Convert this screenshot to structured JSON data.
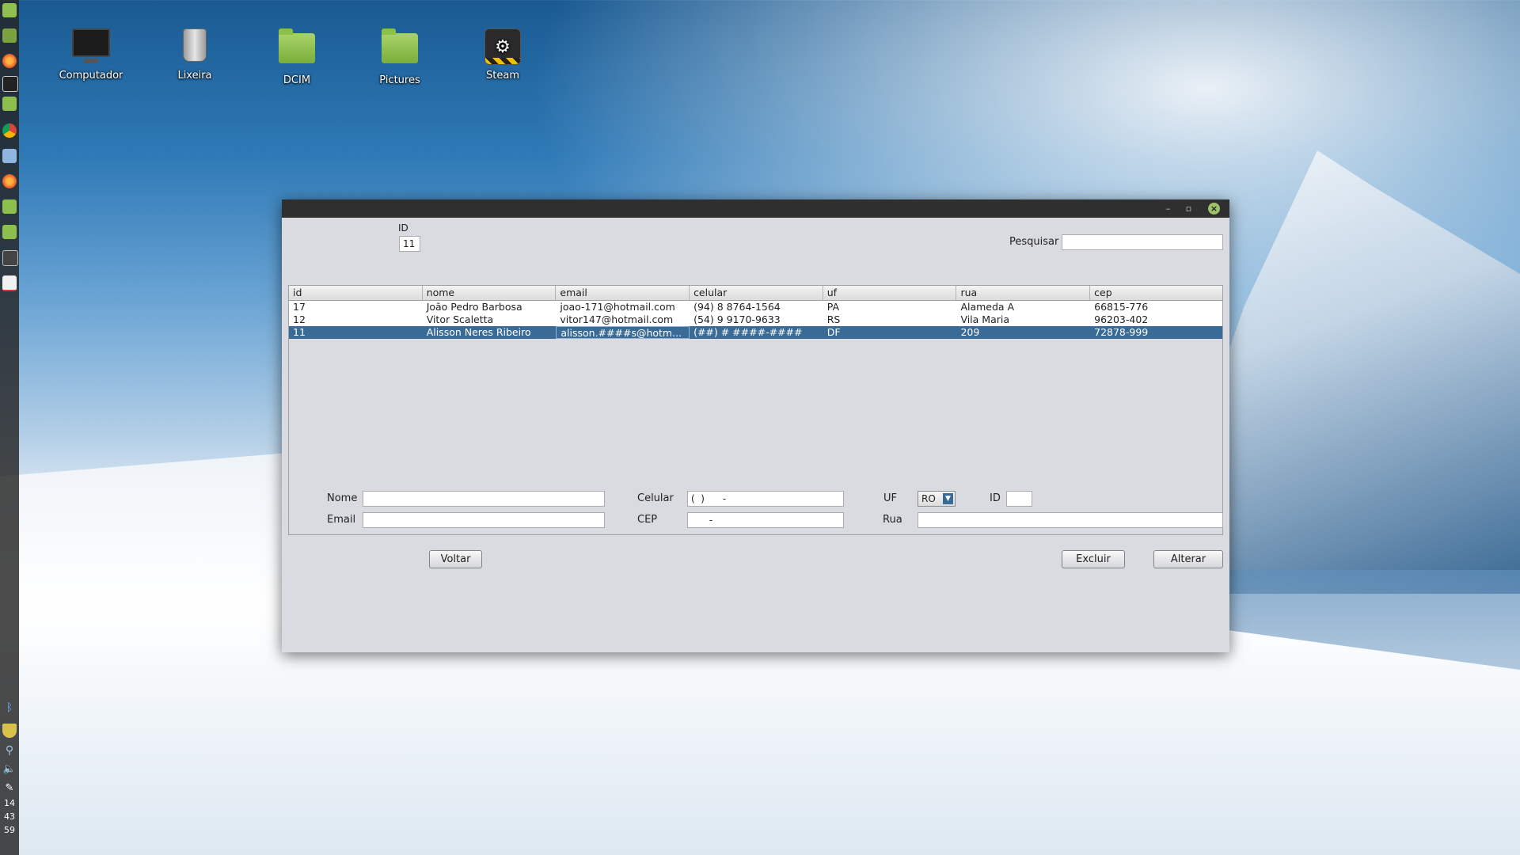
{
  "desktop": {
    "icons": [
      {
        "label": "Computador",
        "icon": "computer-icon"
      },
      {
        "label": "Lixeira",
        "icon": "trash-icon"
      },
      {
        "label": "DCIM",
        "icon": "folder-icon"
      },
      {
        "label": "Pictures",
        "icon": "folder-icon"
      },
      {
        "label": "Steam",
        "icon": "steam-icon"
      }
    ]
  },
  "panel": {
    "clock": {
      "hour": "14",
      "minute": "43",
      "second": "59"
    },
    "launchers": [
      "mint-menu-icon",
      "show-desktop-icon",
      "firefox-icon",
      "terminal-icon",
      "files-icon",
      "chrome-icon",
      "virtualbox-icon",
      "firefox-icon",
      "folder-icon",
      "folder-icon",
      "media-player-icon",
      "java-icon"
    ],
    "tray": [
      "bluetooth-icon",
      "shield-icon",
      "network-icon",
      "volume-icon",
      "pen-icon"
    ]
  },
  "window": {
    "title_controls": {
      "minimize": "–",
      "maximize": "▫",
      "close": "×"
    },
    "top": {
      "id_label": "ID",
      "id_value": "11",
      "search_label": "Pesquisar",
      "search_value": ""
    },
    "table": {
      "columns": [
        "id",
        "nome",
        "email",
        "celular",
        "uf",
        "rua",
        "cep"
      ],
      "rows": [
        [
          "17",
          "João Pedro Barbosa",
          "joao-171@hotmail.com",
          "(94) 8 8764-1564",
          "PA",
          "Alameda A",
          "66815-776"
        ],
        [
          "12",
          "Vitor Scaletta",
          "vitor147@hotmail.com",
          "(54) 9 9170-9633",
          "RS",
          "Vila Maria",
          "96203-402"
        ],
        [
          "11",
          "Alisson Neres Ribeiro",
          "alisson.####s@hotm...",
          "(##) # ####-####",
          "DF",
          "209",
          "72878-999"
        ]
      ],
      "selected_row": 2
    },
    "form": {
      "nome_label": "Nome",
      "nome_value": "",
      "email_label": "Email",
      "email_value": "",
      "celular_label": "Celular",
      "celular_value": "(  )      -",
      "cep_label": "CEP",
      "cep_value": "      -",
      "uf_label": "UF",
      "uf_value": "RO",
      "id_label": "ID",
      "id_value": "",
      "rua_label": "Rua",
      "rua_value": ""
    },
    "buttons": {
      "voltar": "Voltar",
      "excluir": "Excluir",
      "alterar": "Alterar"
    }
  },
  "colors": {
    "selection": "#3a6a96",
    "window_bg": "#d9dbe0",
    "titlebar": "#2f2f2f"
  }
}
